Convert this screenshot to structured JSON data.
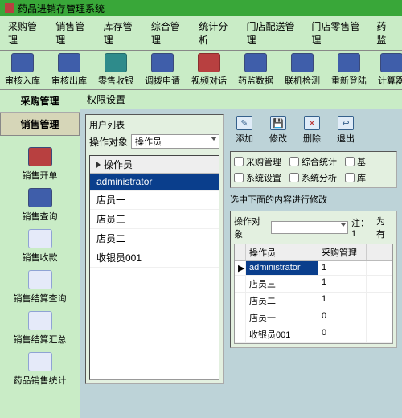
{
  "title": "药品进销存管理系统",
  "menu": [
    "采购管理",
    "销售管理",
    "库存管理",
    "综合管理",
    "统计分析",
    "门店配送管理",
    "门店零售管理",
    "药监"
  ],
  "toolbar": [
    {
      "label": "审核入库",
      "icon": "in"
    },
    {
      "label": "审核出库",
      "icon": "out"
    },
    {
      "label": "零售收银",
      "icon": "cash"
    },
    {
      "label": "调拨申请",
      "icon": "req"
    },
    {
      "label": "视频对话",
      "icon": "video"
    },
    {
      "label": "药监数据",
      "icon": "data"
    },
    {
      "label": "联机检测",
      "icon": "check"
    },
    {
      "label": "重新登陆",
      "icon": "relogin"
    },
    {
      "label": "计算器",
      "icon": "calc"
    }
  ],
  "sidetabs": {
    "t1": "采购管理",
    "t2": "销售管理"
  },
  "sideitems": [
    {
      "label": "销售开单",
      "color": "red"
    },
    {
      "label": "销售查询",
      "color": "blue"
    },
    {
      "label": "销售收款",
      "color": "light"
    },
    {
      "label": "销售结算查询",
      "color": "light"
    },
    {
      "label": "销售结算汇总",
      "color": "light"
    },
    {
      "label": "药品销售统计",
      "color": "light"
    }
  ],
  "panel_title": "权限设置",
  "userlist": {
    "title": "用户列表",
    "object_label": "操作对象",
    "object_value": "操作员",
    "header": "操作员",
    "items": [
      "administrator",
      "店员一",
      "店员三",
      "店员二",
      "收银员001"
    ],
    "selected": 0
  },
  "actions": {
    "add": "添加",
    "edit": "修改",
    "del": "删除",
    "exit": "退出"
  },
  "checkboxes": [
    "采购管理",
    "综合统计",
    "基",
    "系统设置",
    "系统分析",
    "库"
  ],
  "perm": {
    "note": "选中下面的内容进行修改",
    "object_label": "操作对象",
    "object_value": "",
    "note2_label": "注：1",
    "note2_value": "为有",
    "header_op": "操作员",
    "header_perm": "采购管理",
    "rows": [
      {
        "name": "administrator",
        "val": "1",
        "sel": true
      },
      {
        "name": "店员三",
        "val": "1"
      },
      {
        "name": "店员二",
        "val": "1"
      },
      {
        "name": "店员一",
        "val": "0"
      },
      {
        "name": "收银员001",
        "val": "0"
      }
    ]
  }
}
